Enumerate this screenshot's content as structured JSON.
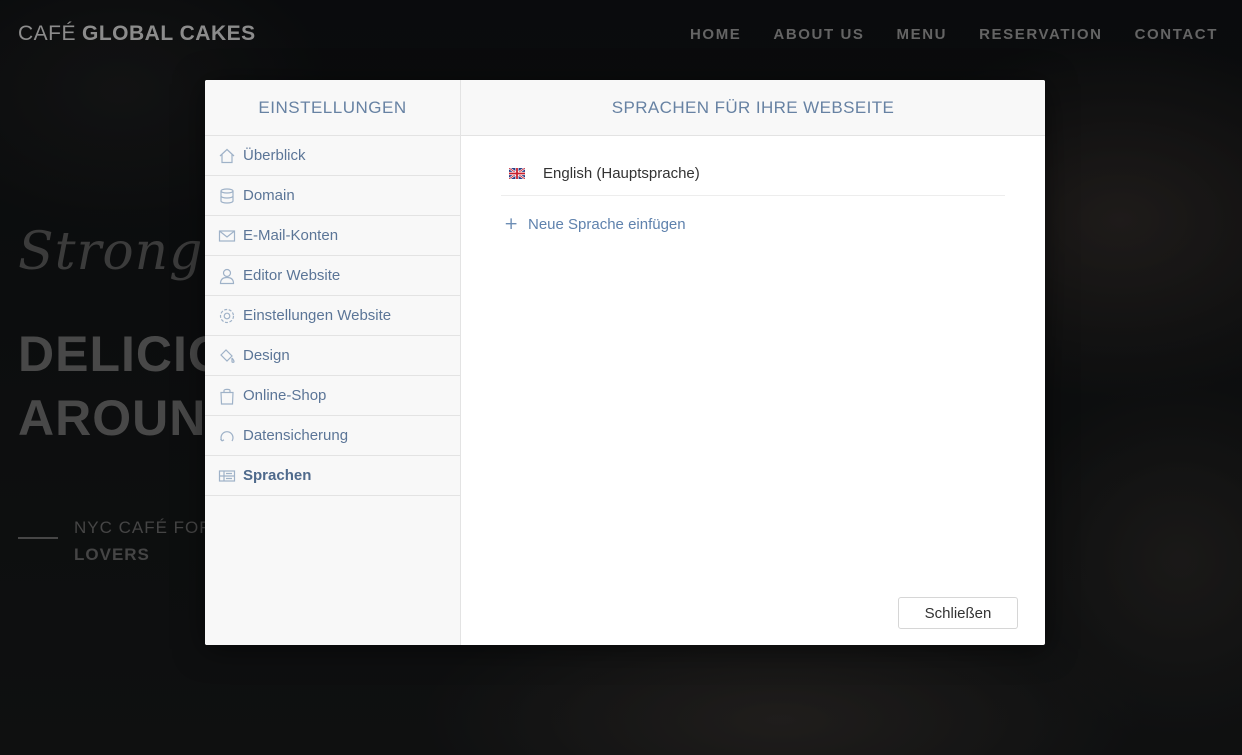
{
  "site": {
    "brand_light": "CAFÉ",
    "brand_bold": "GLOBAL CAKES",
    "nav": [
      "HOME",
      "ABOUT US",
      "MENU",
      "RESERVATION",
      "CONTACT"
    ],
    "hero_script": "Strong c",
    "hero_title_line1": "DELICIO",
    "hero_title_line2": "AROUND",
    "hero_sub_line1": "NYC CAFÉ FOR",
    "hero_sub_line2": "LOVERS"
  },
  "settings": {
    "title": "EINSTELLUNGEN",
    "items": [
      {
        "label": "Überblick",
        "icon": "home-icon"
      },
      {
        "label": "Domain",
        "icon": "database-icon"
      },
      {
        "label": "E-Mail-Konten",
        "icon": "mail-icon"
      },
      {
        "label": "Editor Website",
        "icon": "user-icon"
      },
      {
        "label": "Einstellungen Website",
        "icon": "gear-icon"
      },
      {
        "label": "Design",
        "icon": "paint-bucket-icon"
      },
      {
        "label": "Online-Shop",
        "icon": "shopping-bag-icon"
      },
      {
        "label": "Datensicherung",
        "icon": "backup-icon"
      },
      {
        "label": "Sprachen",
        "icon": "languages-icon",
        "active": true
      }
    ]
  },
  "languages": {
    "title": "SPRACHEN FÜR IHRE WEBSEITE",
    "list": [
      {
        "label": "English (Hauptsprache)",
        "flag": "uk-flag-icon"
      }
    ],
    "add_label": "Neue Sprache einfügen",
    "close_label": "Schließen"
  },
  "colors": {
    "accent": "#6782a3",
    "link": "#5f82ad",
    "icon": "#9fb2c8"
  }
}
